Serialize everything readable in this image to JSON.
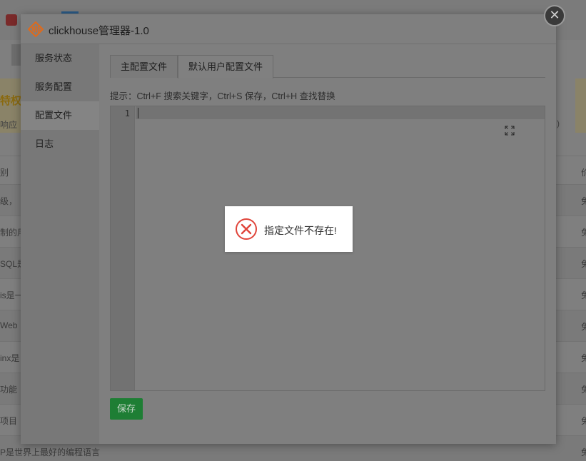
{
  "background": {
    "title": "特权",
    "subtitle_left": "响应",
    "subtitle_right": ")",
    "rows": [
      {
        "text": "别",
        "end": "价"
      },
      {
        "text": "级，",
        "end": "免"
      },
      {
        "text": "制的用",
        "end": "免"
      },
      {
        "text": "SQL是",
        "end": "免"
      },
      {
        "text": "is是一",
        "end": "免"
      },
      {
        "text": "Web",
        "end": "免"
      },
      {
        "text": "inx是",
        "end": "免"
      },
      {
        "text": "功能",
        "end": "免"
      },
      {
        "text": "项目",
        "end": "免"
      },
      {
        "text": "P是世界上最好的编程语言",
        "end": "免"
      }
    ]
  },
  "modal": {
    "title": "clickhouse管理器-1.0",
    "close_label": "✕",
    "sidebar": [
      {
        "label": "服务状态"
      },
      {
        "label": "服务配置"
      },
      {
        "label": "配置文件",
        "active": true
      },
      {
        "label": "日志"
      }
    ],
    "tabs": [
      {
        "label": "主配置文件"
      },
      {
        "label": "默认用户配置文件",
        "active": true
      }
    ],
    "hint": "提示：Ctrl+F 搜索关键字，Ctrl+S 保存，Ctrl+H 查找替换",
    "editor": {
      "line_numbers": [
        "1"
      ],
      "content": ""
    },
    "save_label": "保存"
  },
  "toast": {
    "message": "指定文件不存在!",
    "icon": "error-circle-icon",
    "icon_color": "#e0443a"
  },
  "colors": {
    "app_icon": "#e06a1a",
    "save_button": "#1e7e34"
  }
}
